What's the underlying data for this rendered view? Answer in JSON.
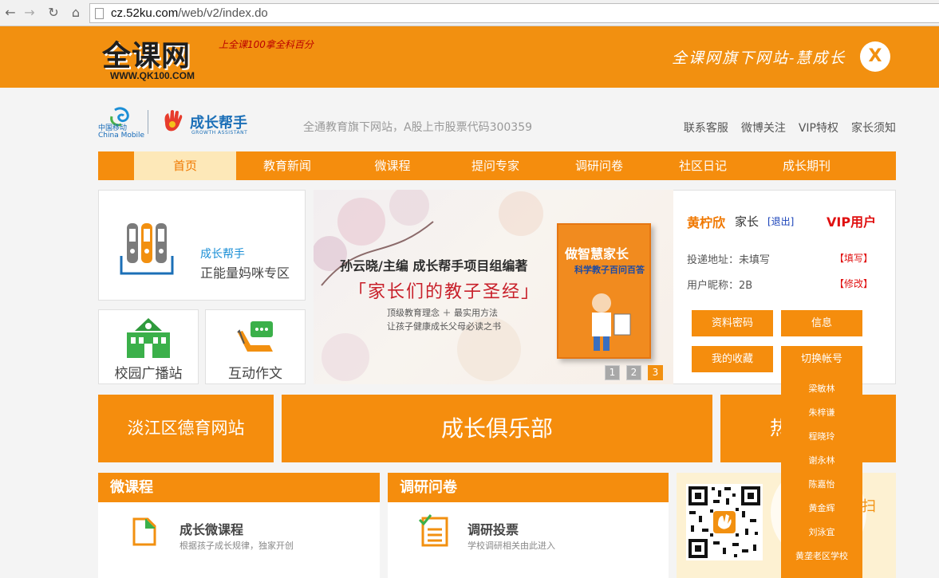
{
  "browser": {
    "back_icon": "arrow-left-icon",
    "forward_icon": "arrow-right-icon",
    "reload_icon": "reload-icon",
    "home_icon": "home-icon",
    "url_host": "cz.52ku.com",
    "url_path": "/web/v2/index.do"
  },
  "banner": {
    "logo_text": "全课网",
    "logo_url": "WWW.QK100.COM",
    "logo_slogan": "上全课100拿全科百分",
    "right_text": "全课网旗下网站-慧成长",
    "close_label": "X"
  },
  "header": {
    "china_mobile_cn": "中国移动",
    "china_mobile_en": "China Mobile",
    "brand_name": "成长帮手",
    "brand_sub": "GROWTH ASSISTANT",
    "slogan": "全通教育旗下网站，A股上市股票代码300359",
    "links": [
      "联系客服",
      "微博关注",
      "VIP特权",
      "家长须知"
    ]
  },
  "nav": {
    "items": [
      "首页",
      "教育新闻",
      "微课程",
      "提问专家",
      "调研问卷",
      "社区日记",
      "成长期刊"
    ],
    "active": "首页"
  },
  "left": {
    "feature_title": "成长帮手",
    "feature_sub": "正能量妈咪专区",
    "campus": "校园广播站",
    "writing": "互动作文"
  },
  "slider": {
    "author": "孙云晓/主编  成长帮手项目组编著",
    "title": "「家长们的教子圣经」",
    "line1": "顶级教育理念  ＋  最实用方法",
    "line2": "让孩子健康成长父母必读之书",
    "book_title": "做智慧家长",
    "book_sub": "科学教子百问百答",
    "pages": [
      "1",
      "2",
      "3"
    ],
    "current_page": "3"
  },
  "user": {
    "name": "黄柠欣",
    "role": "家长",
    "logout": "[退出]",
    "vip": "VIP用户",
    "address_label": "投递地址：未填写",
    "address_action": "【填写】",
    "nickname_label": "用户昵称：2B",
    "nickname_action": "【修改】",
    "buttons": [
      "资料密码",
      "信息",
      "我的收藏",
      "切换帐号"
    ]
  },
  "dropdown": {
    "items": [
      "梁敏林",
      "朱梓谦",
      "程晓玲",
      "谢永林",
      "陈嘉怡",
      "黄金辉",
      "刘泳宜",
      "黄垄老区学校"
    ]
  },
  "tiles": {
    "left": "淡江区德育网站",
    "center": "成长俱乐部",
    "right_partial": "热"
  },
  "sections": {
    "micro": {
      "header": "微课程",
      "title": "成长微课程",
      "sub": "根据孩子成长规律，独家开创"
    },
    "survey": {
      "header": "调研问卷",
      "title": "调研投票",
      "sub": "学校调研相关由此进入"
    },
    "qr": {
      "scan_text": "扫"
    }
  },
  "colors": {
    "brand_orange": "#f58d0d",
    "banner_orange": "#f29010",
    "link_blue": "#1b6fb7",
    "alert_red": "#e01010"
  }
}
